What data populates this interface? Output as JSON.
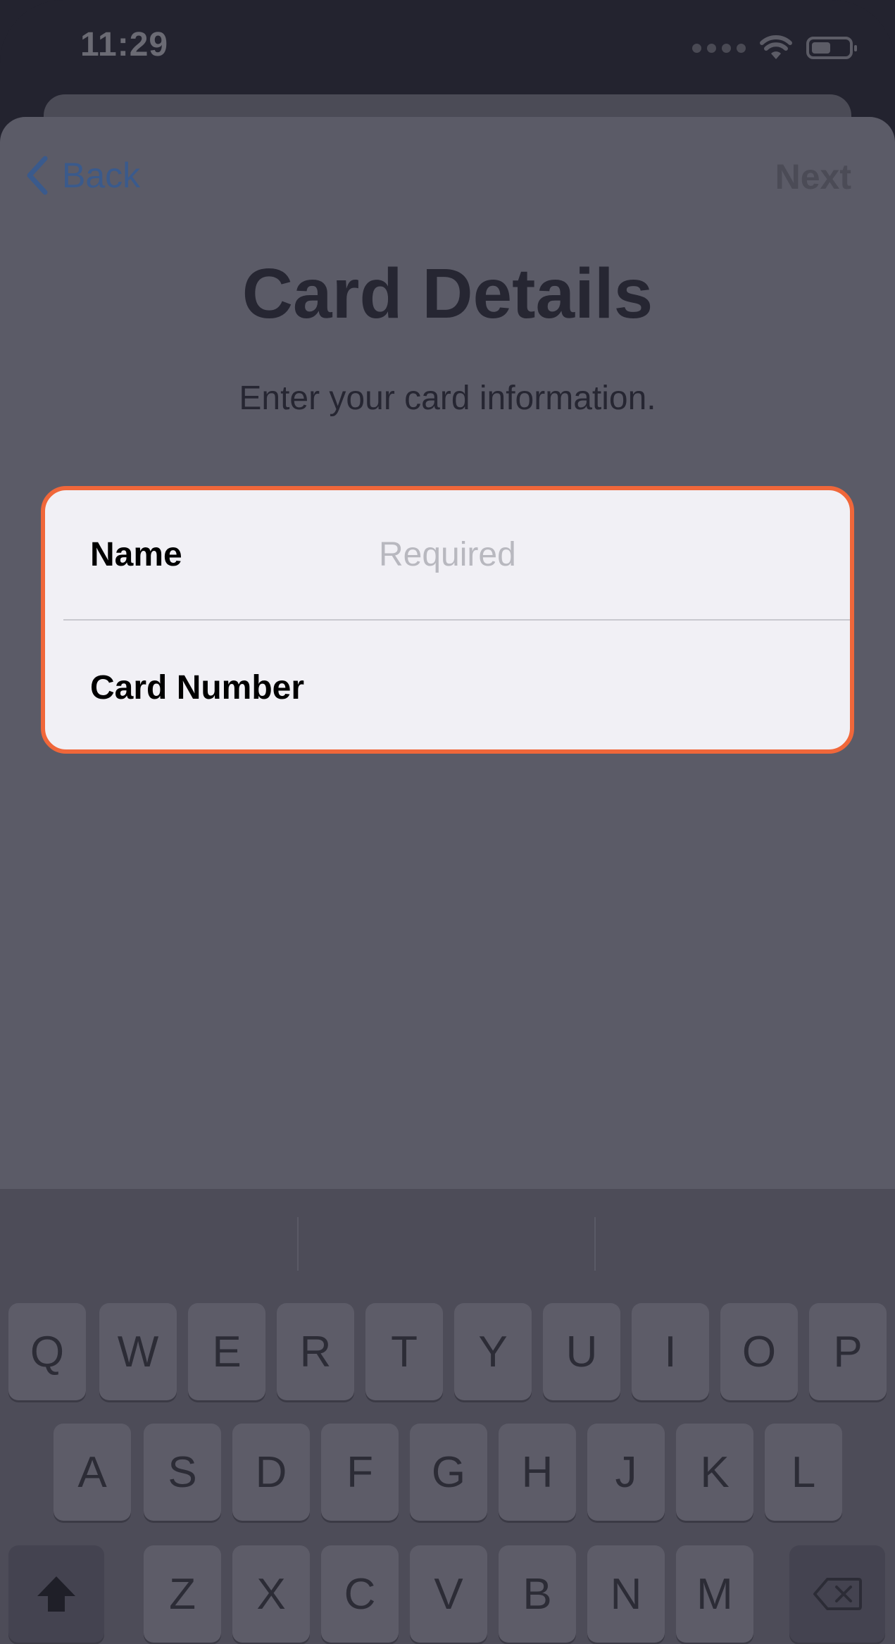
{
  "status_bar": {
    "time": "11:29"
  },
  "nav": {
    "back_label": "Back",
    "next_label": "Next"
  },
  "header": {
    "title": "Card Details",
    "subtitle": "Enter your card information."
  },
  "form": {
    "name_label": "Name",
    "name_placeholder": "Required",
    "name_value": "",
    "card_number_label": "Card Number",
    "card_number_value": "",
    "highlight_color": "#f0673a"
  },
  "keyboard": {
    "row1": [
      "Q",
      "W",
      "E",
      "R",
      "T",
      "Y",
      "U",
      "I",
      "O",
      "P"
    ],
    "row2": [
      "A",
      "S",
      "D",
      "F",
      "G",
      "H",
      "J",
      "K",
      "L"
    ],
    "row3": [
      "Z",
      "X",
      "C",
      "V",
      "B",
      "N",
      "M"
    ]
  }
}
